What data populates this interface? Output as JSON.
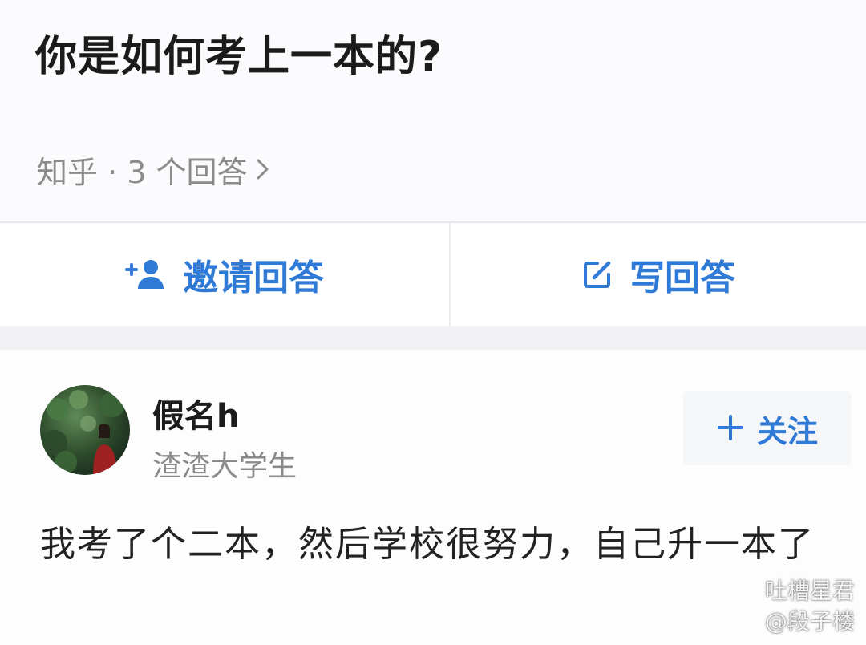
{
  "question": {
    "title": "你是如何考上一本的?",
    "meta": "知乎 · 3 个回答"
  },
  "actions": {
    "invite_label": "邀请回答",
    "write_label": "写回答"
  },
  "answer": {
    "author_name": "假名h",
    "author_bio": "渣渣大学生",
    "follow_label": "关注",
    "text": "我考了个二本，然后学校很努力，自己升一本了"
  },
  "watermark": {
    "line1": "吐槽星君",
    "line2": "@段子楼"
  },
  "colors": {
    "accent": "#2f7ad6",
    "meta_gray": "#8c8c8c"
  },
  "icons": {
    "invite": "add-user-icon",
    "write": "edit-icon",
    "follow": "plus-icon",
    "meta": "chevron-right-icon",
    "watermark_1": "wechat-icon",
    "watermark_2": "weibo-icon"
  }
}
